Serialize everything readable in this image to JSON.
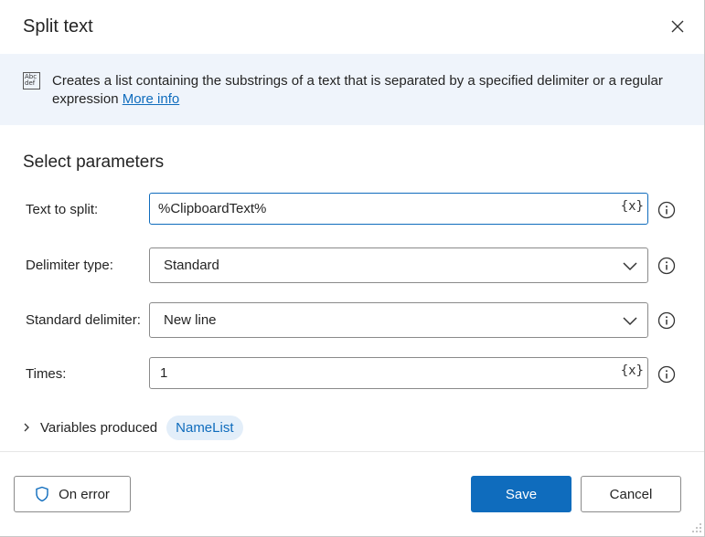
{
  "dialog": {
    "title": "Split text",
    "close_icon": "close-icon"
  },
  "banner": {
    "icon": "text-action-icon",
    "icon_text_line1": "Abc",
    "icon_text_line2": "def",
    "description": "Creates a list containing the substrings of a text that is separated by a specified delimiter or a regular expression",
    "link_label": "More info"
  },
  "params": {
    "section_title": "Select parameters",
    "text_to_split": {
      "label": "Text to split:",
      "value": "%ClipboardText%",
      "var_button": "{x}"
    },
    "delimiter_type": {
      "label": "Delimiter type:",
      "value": "Standard"
    },
    "standard_delimiter": {
      "label": "Standard delimiter:",
      "value": "New line"
    },
    "times": {
      "label": "Times:",
      "value": "1",
      "var_button": "{x}"
    }
  },
  "variables": {
    "toggle_label": "Variables produced",
    "items": [
      "NameList"
    ]
  },
  "footer": {
    "on_error_label": "On error",
    "save_label": "Save",
    "cancel_label": "Cancel"
  },
  "colors": {
    "accent": "#0f6cbd",
    "banner_bg": "#eff4fb",
    "pill_bg": "#e3eef9"
  }
}
